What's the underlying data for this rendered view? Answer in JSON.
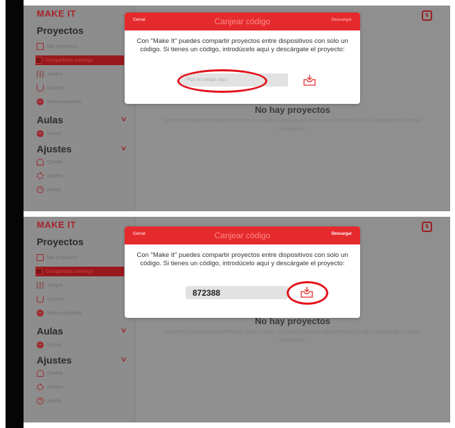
{
  "app": {
    "logo": "MAKE IT",
    "sections": {
      "proyectos": "Proyectos",
      "aulas": "Aulas",
      "ajustes": "Ajustes"
    },
    "menu": {
      "mis_proyectos": "Mis proyectos",
      "compartidos": "Compartidos conmigo",
      "juegos": "Juegos",
      "quizzes": "Quizzes",
      "nuevo_proyecto": "Nuevo proyecto",
      "unirse": "Unirse",
      "cuenta": "Cuenta",
      "ajustes": "Ajustes",
      "ayuda": "Ayuda"
    },
    "icons": {
      "mis_proyectos": "folder-icon",
      "compartidos": "shared-icon",
      "juegos": "grid-icon",
      "quizzes": "trophy-icon",
      "nuevo_proyecto": "plus-icon",
      "unirse": "plus-icon",
      "cuenta": "user-icon",
      "ajustes": "gear-icon",
      "ayuda": "help-icon",
      "top_right": "sort-icon",
      "download": "download-icon"
    },
    "empty": {
      "title": "No hay proyectos",
      "subtitle": "No tienes proyectos compartidos por otros usuarios. Consigue proyectos apuntándote a un aula o canjeando un código de proyecto."
    },
    "colors": {
      "accent": "#e52a2d",
      "highlight": "#e3121b"
    }
  },
  "modal": {
    "close": "Cerrar",
    "title": "Canjear código",
    "download": "Descargar",
    "description": "Con \"Make It\" puedes compartir proyectos entre dispositivos con solo un código. Si tienes un código, introdúcelo aquí y descárgate el proyecto:",
    "placeholder": "Pon el código aquí"
  },
  "screens": {
    "first": {
      "code_value": ""
    },
    "second": {
      "code_value": "872388"
    }
  }
}
